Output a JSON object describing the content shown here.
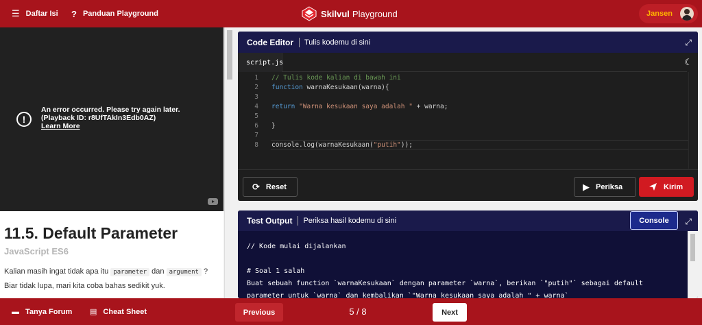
{
  "topbar": {
    "toc_label": "Daftar Isi",
    "guide_label": "Panduan Playground",
    "brand_bold": "Skilvul",
    "brand_rest": "Playground",
    "user_name": "Jansen"
  },
  "video": {
    "error_message": "An error occurred. Please try again later. (Playback ID: r8UfTAkIn3Edb0AZ)",
    "learn_more": "Learn More"
  },
  "article": {
    "title": "11.5. Default Parameter",
    "subtitle": "JavaScript ES6",
    "text_1": "Kalian masih ingat tidak apa itu",
    "code_1": "parameter",
    "text_2": "dan",
    "code_2": "argument",
    "text_3": "? Biar tidak lupa, mari kita coba bahas sedikit yuk."
  },
  "editor": {
    "title": "Code Editor",
    "subtitle": "Tulis kodemu di sini",
    "tab": "script.js",
    "line_numbers": [
      "1",
      "2",
      "3",
      "4",
      "5",
      "6",
      "7",
      "8"
    ],
    "lines": {
      "l1": "// Tulis kode kalian di bawah ini",
      "l2_kw": "function",
      "l2_rest": " warnaKesukaan(warna){",
      "l4_kw": "return",
      "l4_str": "\"Warna kesukaan saya adalah \"",
      "l4_rest": " + warna;",
      "l6": "}",
      "l8_a": "console.log(warnaKesukaan(",
      "l8_str": "\"putih\"",
      "l8_b": "));"
    },
    "reset_label": "Reset",
    "check_label": "Periksa",
    "submit_label": "Kirim"
  },
  "output": {
    "title": "Test Output",
    "subtitle": "Periksa hasil kodemu di sini",
    "console_label": "Console",
    "lines": [
      "// Kode mulai dijalankan",
      "",
      "# Soal 1 salah",
      "Buat sebuah function `warnaKesukaan` dengan parameter `warna`, berikan `\"putih\"` sebagai default",
      "parameter untuk `warna` dan kembalikan `\"Warna kesukaan saya adalah \" + warna`"
    ]
  },
  "bottombar": {
    "forum_label": "Tanya Forum",
    "cheat_label": "Cheat Sheet",
    "prev_label": "Previous",
    "page": "5 / 8",
    "next_label": "Next"
  },
  "colors": {
    "brand_red": "#a8141c",
    "panel_navy": "#1a1a4b",
    "editor_bg": "#1e1e1e",
    "submit_red": "#d11a21",
    "user_name": "#ffb300"
  }
}
